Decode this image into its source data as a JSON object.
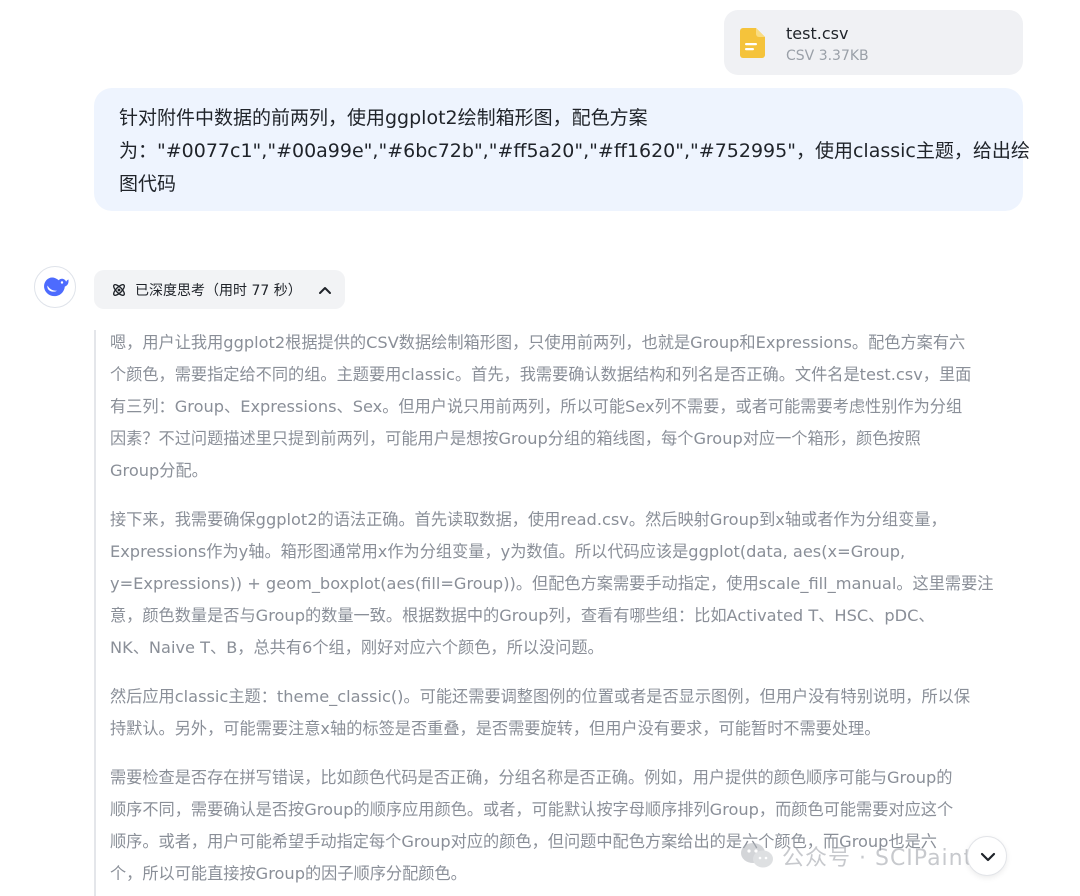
{
  "attachment": {
    "file_name": "test.csv",
    "file_meta": "CSV 3.37KB",
    "icon": "document-icon",
    "icon_color": "#f5c33b"
  },
  "user_message": {
    "lines": [
      "针对附件中数据的前两列，使用ggplot2绘制箱形图，配色方案",
      "为：\"#0077c1\",\"#00a99e\",\"#6bc72b\",\"#ff5a20\",\"#ff1620\",\"#752995\"，使用classic主题，给出绘",
      "图代码"
    ],
    "bubble_color": "#eef4fe"
  },
  "assistant": {
    "avatar_icon": "whale-logo-icon",
    "brand_color": "#4d6bfe",
    "think_label": "已深度思考（用时 77 秒）",
    "paragraphs": [
      [
        "嗯，用户让我用ggplot2根据提供的CSV数据绘制箱形图，只使用前两列，也就是Group和Expressions。配色方案有六",
        "个颜色，需要指定给不同的组。主题要用classic。首先，我需要确认数据结构和列名是否正确。文件名是test.csv，里面",
        "有三列：Group、Expressions、Sex。但用户说只用前两列，所以可能Sex列不需要，或者可能需要考虑性别作为分组",
        "因素？不过问题描述里只提到前两列，可能用户是想按Group分组的箱线图，每个Group对应一个箱形，颜色按照",
        "Group分配。"
      ],
      [
        "接下来，我需要确保ggplot2的语法正确。首先读取数据，使用read.csv。然后映射Group到x轴或者作为分组变量，",
        "Expressions作为y轴。箱形图通常用x作为分组变量，y为数值。所以代码应该是ggplot(data, aes(x=Group,",
        "y=Expressions)) + geom_boxplot(aes(fill=Group))。但配色方案需要手动指定，使用scale_fill_manual。这里需要注",
        "意，颜色数量是否与Group的数量一致。根据数据中的Group列，查看有哪些组：比如Activated T、HSC、pDC、",
        "NK、Naive T、B，总共有6个组，刚好对应六个颜色，所以没问题。"
      ],
      [
        "然后应用classic主题：theme_classic()。可能还需要调整图例的位置或者是否显示图例，但用户没有特别说明，所以保",
        "持默认。另外，可能需要注意x轴的标签是否重叠，是否需要旋转，但用户没有要求，可能暂时不需要处理。"
      ],
      [
        "需要检查是否存在拼写错误，比如颜色代码是否正确，分组名称是否正确。例如，用户提供的颜色顺序可能与Group的",
        "顺序不同，需要确认是否按Group的顺序应用颜色。或者，可能默认按字母顺序排列Group，而颜色可能需要对应这个",
        "顺序。或者，用户可能希望手动指定每个Group对应的颜色，但问题中配色方案给出的是六个颜色，而Group也是六",
        "个，所以可能直接按Group的因子顺序分配颜色。"
      ]
    ]
  },
  "watermark": {
    "text": "公众号 · SCIPainter"
  },
  "scroll_button": {
    "icon": "chevron-down-icon"
  }
}
